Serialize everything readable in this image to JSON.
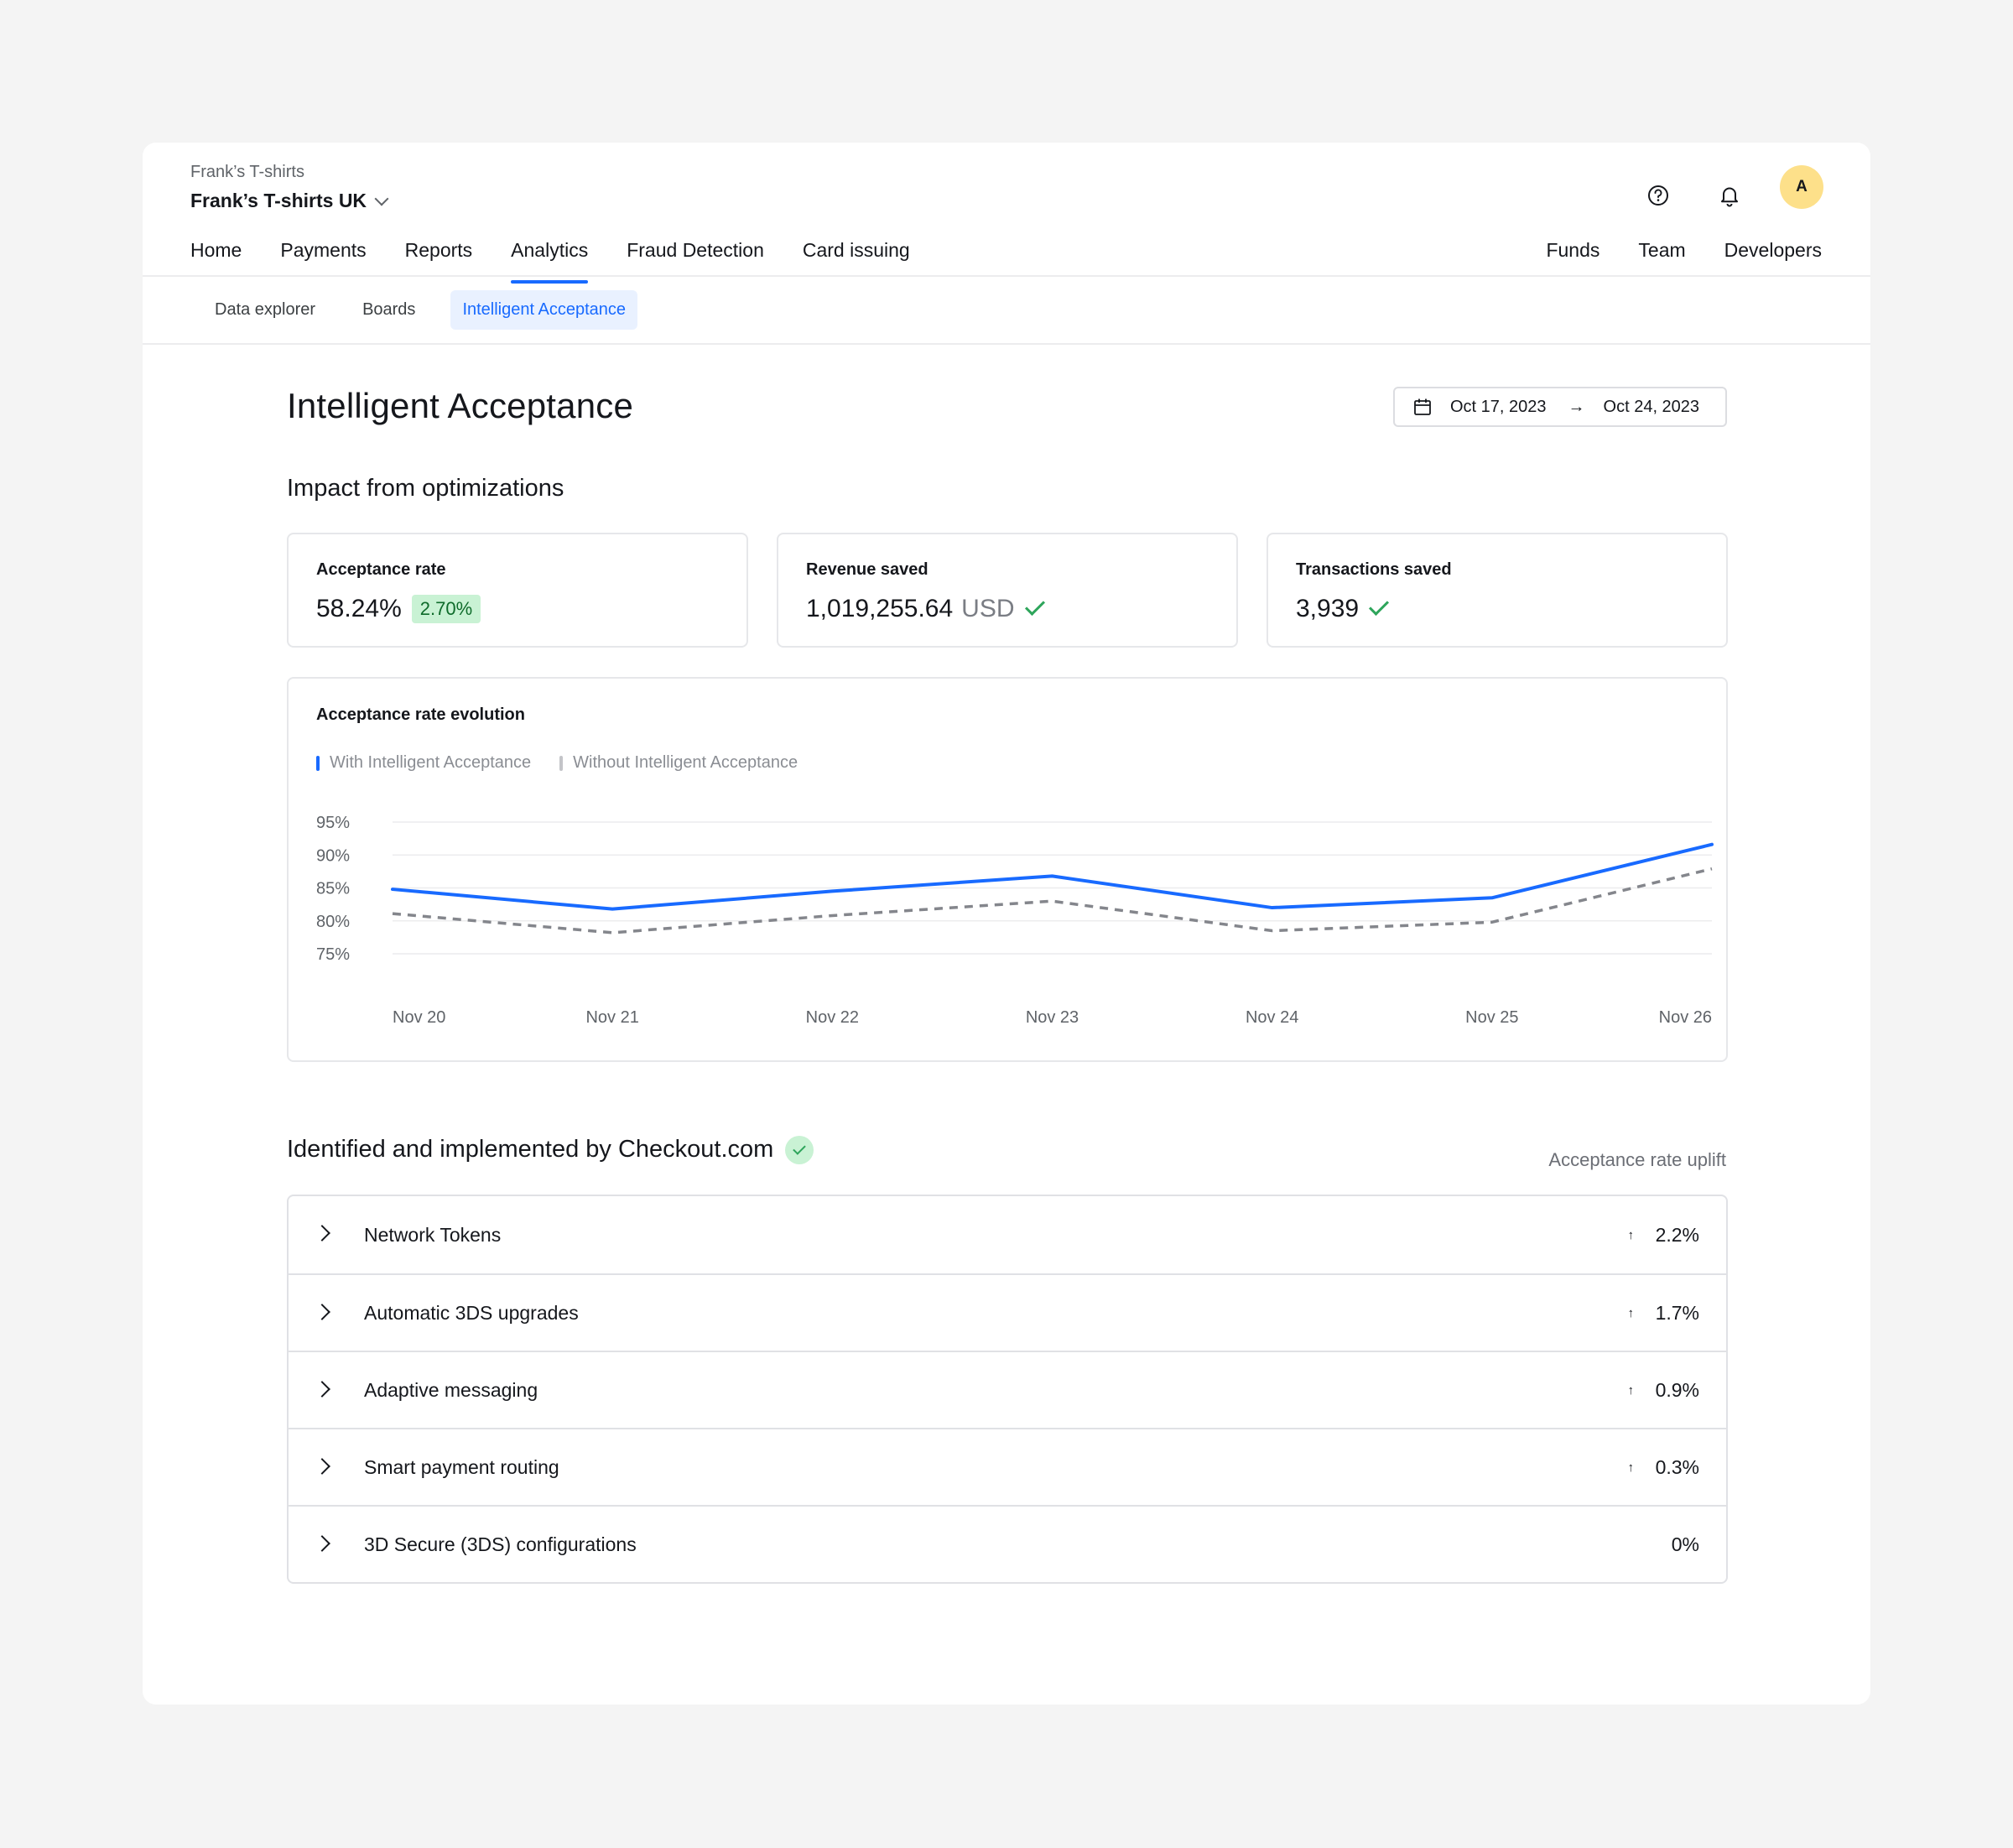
{
  "header": {
    "org_parent": "Frank’s T-shirts",
    "org_name": "Frank’s T-shirts UK",
    "avatar_initial": "A",
    "help_icon": "question-circle-icon",
    "bell_icon": "bell-icon"
  },
  "nav": {
    "left": [
      "Home",
      "Payments",
      "Reports",
      "Analytics",
      "Fraud Detection",
      "Card issuing"
    ],
    "right": [
      "Funds",
      "Team",
      "Developers"
    ],
    "active": "Analytics"
  },
  "subnav": {
    "items": [
      "Data explorer",
      "Boards",
      "Intelligent Acceptance"
    ],
    "active": "Intelligent Acceptance"
  },
  "page": {
    "title": "Intelligent Acceptance",
    "date_from": "Oct 17, 2023",
    "date_to": "Oct 24, 2023",
    "date_arrow": "→"
  },
  "impact": {
    "title": "Impact from optimizations",
    "kpis": [
      {
        "label": "Acceptance rate",
        "value": "58.24%",
        "badge": "2.70%"
      },
      {
        "label": "Revenue saved",
        "value": "1,019,255.64",
        "unit": "USD",
        "check": true
      },
      {
        "label": "Transactions saved",
        "value": "3,939",
        "check": true
      }
    ]
  },
  "chart_data": {
    "type": "line",
    "title": "Acceptance rate evolution",
    "x": [
      "Nov 20",
      "Nov 21",
      "Nov 22",
      "Nov 23",
      "Nov 24",
      "Nov 25",
      "Nov 26"
    ],
    "series": [
      {
        "name": "With Intelligent Acceptance",
        "color": "#186aff",
        "style": "solid",
        "values": [
          84.8,
          81.8,
          84.5,
          86.8,
          82.0,
          83.5,
          91.6
        ]
      },
      {
        "name": "Without Intelligent Acceptance",
        "color": "#84868c",
        "style": "dashed",
        "values": [
          81.1,
          78.2,
          80.8,
          83.0,
          78.5,
          79.8,
          87.9
        ]
      }
    ],
    "yticks": [
      "95%",
      "90%",
      "85%",
      "80%",
      "75%"
    ],
    "ytick_values": [
      95,
      90,
      85,
      80,
      75
    ],
    "ylim": [
      75,
      95
    ],
    "grid": true,
    "legend_position": "top-left"
  },
  "implemented": {
    "title": "Identified and implemented by Checkout.com",
    "uplift_header": "Acceptance rate uplift",
    "rows": [
      {
        "label": "Network Tokens",
        "arrow": "↑",
        "value": "2.2%"
      },
      {
        "label": "Automatic 3DS upgrades",
        "arrow": "↑",
        "value": "1.7%"
      },
      {
        "label": "Adaptive messaging",
        "arrow": "↑",
        "value": "0.9%"
      },
      {
        "label": "Smart payment routing",
        "arrow": "↑",
        "value": "0.3%"
      },
      {
        "label": "3D Secure (3DS) configurations",
        "arrow": "",
        "value": "0%"
      }
    ]
  }
}
